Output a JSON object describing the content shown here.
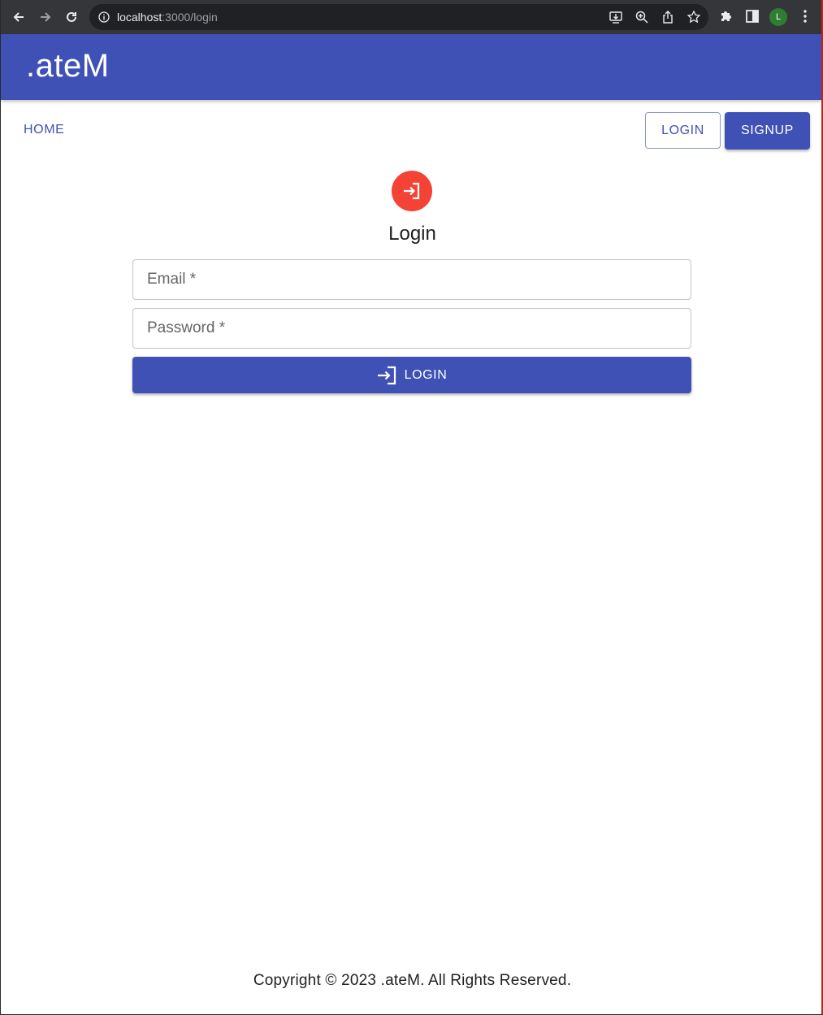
{
  "browser": {
    "url_host": "localhost",
    "url_path": ":3000/login",
    "profile_initial": "L",
    "icons": [
      "back-arrow-icon",
      "forward-arrow-icon",
      "reload-icon",
      "info-icon",
      "install-app-icon",
      "zoom-icon",
      "share-icon",
      "bookmark-star-icon",
      "extensions-puzzle-icon",
      "side-panel-icon",
      "kebab-menu-icon"
    ]
  },
  "appbar": {
    "brand": ".ateM"
  },
  "nav": {
    "home_label": "HOME",
    "login_label": "LOGIN",
    "signup_label": "SIGNUP"
  },
  "form": {
    "icon": "login-icon",
    "title": "Login",
    "email_placeholder": "Email *",
    "email_value": "",
    "password_placeholder": "Password *",
    "password_value": "",
    "submit_label": "LOGIN"
  },
  "footer": {
    "copyright": "Copyright © 2023 .ateM. All Rights Reserved."
  },
  "colors": {
    "primary": "#3f51b5",
    "avatar": "#f44336",
    "chrome": "#35363a",
    "omnibox": "#202124"
  }
}
